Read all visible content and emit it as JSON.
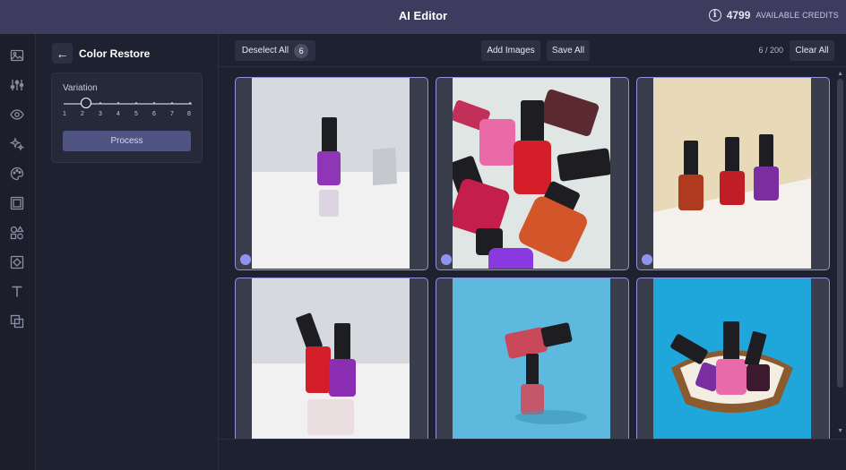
{
  "header": {
    "title": "AI Editor",
    "credits_value": "4799",
    "credits_label": "AVAILABLE CREDITS"
  },
  "rail": {
    "icons": [
      "image-icon",
      "sliders-icon",
      "eye-icon",
      "sparkle-icon",
      "palette-icon",
      "frame-icon",
      "shapes-icon",
      "crop-icon",
      "text-icon",
      "layers-icon"
    ]
  },
  "panel": {
    "title": "Color Restore",
    "variation_label": "Variation",
    "variation_value": 2,
    "ticks": [
      "1",
      "2",
      "3",
      "4",
      "5",
      "6",
      "7",
      "8"
    ],
    "process_label": "Process"
  },
  "toolbar": {
    "deselect_label": "Deselect All",
    "selected_count": "6",
    "add_images_label": "Add Images",
    "save_all_label": "Save All",
    "counter": "6 / 200",
    "clear_all_label": "Clear All"
  },
  "gallery": {
    "images": [
      {
        "subject": "single-purple-bottle",
        "selected": true
      },
      {
        "subject": "scattered-bottles",
        "selected": true
      },
      {
        "subject": "three-bottles",
        "selected": true
      },
      {
        "subject": "red-and-purple-bottles",
        "selected": true
      },
      {
        "subject": "stacked-bottles",
        "selected": true
      },
      {
        "subject": "bottles-in-coconut",
        "selected": true
      }
    ]
  },
  "colors": {
    "accent": "#8f94f0",
    "header_bg": "#3d3b5e",
    "button_bg": "#4f5483"
  }
}
